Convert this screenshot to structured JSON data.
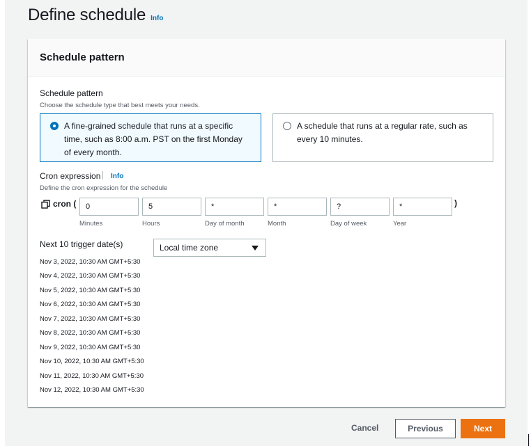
{
  "page": {
    "title": "Define schedule",
    "info": "Info"
  },
  "container": {
    "title": "Schedule pattern"
  },
  "schedule_pattern": {
    "label": "Schedule pattern",
    "description": "Choose the schedule type that best meets your needs.",
    "options": [
      {
        "label": "A fine-grained schedule that runs at a specific time, such as 8:00 a.m. PST on the first Monday of every month.",
        "selected": true
      },
      {
        "label": "A schedule that runs at a regular rate, such as every 10 minutes.",
        "selected": false
      }
    ]
  },
  "cron": {
    "label": "Cron expression",
    "info": "Info",
    "description": "Define the cron expression for the schedule",
    "prefix": "cron (",
    "suffix": ")",
    "fields": [
      {
        "value": "0",
        "label": "Minutes"
      },
      {
        "value": "5",
        "label": "Hours"
      },
      {
        "value": "*",
        "label": "Day of month"
      },
      {
        "value": "*",
        "label": "Month"
      },
      {
        "value": "?",
        "label": "Day of week"
      },
      {
        "value": "*",
        "label": "Year"
      }
    ]
  },
  "triggers": {
    "label": "Next 10 trigger date(s)",
    "timezone": "Local time zone",
    "dates": [
      "Nov 3, 2022, 10:30 AM GMT+5:30",
      "Nov 4, 2022, 10:30 AM GMT+5:30",
      "Nov 5, 2022, 10:30 AM GMT+5:30",
      "Nov 6, 2022, 10:30 AM GMT+5:30",
      "Nov 7, 2022, 10:30 AM GMT+5:30",
      "Nov 8, 2022, 10:30 AM GMT+5:30",
      "Nov 9, 2022, 10:30 AM GMT+5:30",
      "Nov 10, 2022, 10:30 AM GMT+5:30",
      "Nov 11, 2022, 10:30 AM GMT+5:30",
      "Nov 12, 2022, 10:30 AM GMT+5:30"
    ]
  },
  "footer": {
    "cancel": "Cancel",
    "previous": "Previous",
    "next": "Next"
  },
  "colors": {
    "accent": "#0073bb",
    "primary_button": "#ec7211"
  },
  "icons": {
    "cron_prefix": "copy-icon",
    "timezone_select": "caret-down-icon"
  }
}
